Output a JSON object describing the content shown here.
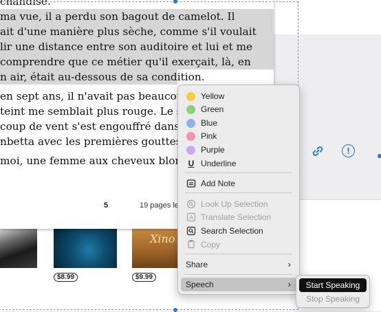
{
  "book": {
    "lines": [
      {
        "text": "chandise.",
        "highlighted": false
      },
      {
        "text": "ma vue, il a perdu son bagout de camelot. Il",
        "highlighted": true
      },
      {
        "text": "ait d'une manière plus sèche, comme s'il voulait",
        "highlighted": true
      },
      {
        "text": "lir une distance entre son auditoire et lui et me",
        "highlighted": true
      },
      {
        "text": "comprendre que ce métier qu'il exerçait, là, en",
        "highlighted": true
      },
      {
        "text": "n air, était au-dessous de sa condition.",
        "highlighted": true
      },
      {
        "text": "en sept ans, il n'avait pas beaucoup c",
        "highlighted": false
      },
      {
        "text": "teint me semblait plus rouge. Le soir",
        "highlighted": false
      },
      {
        "text": "coup de vent s'est engouffré dans l",
        "highlighted": false
      },
      {
        "text": "nbetta avec les premières gouttes de p",
        "highlighted": false
      },
      {
        "text": "moi, une femme aux cheveux blon",
        "highlighted": false
      }
    ],
    "page_number": "5",
    "pages_left": "19 pages le"
  },
  "store": {
    "cover3_title": "Xino",
    "prices": [
      "$8.99",
      "$9.99"
    ]
  },
  "context_menu": {
    "colors": [
      {
        "label": "Yellow",
        "color": "#f5cc3a"
      },
      {
        "label": "Green",
        "color": "#86d37a"
      },
      {
        "label": "Blue",
        "color": "#8fb1f1"
      },
      {
        "label": "Pink",
        "color": "#f592ae"
      },
      {
        "label": "Purple",
        "color": "#c7a8f1"
      }
    ],
    "underline": {
      "icon": "U",
      "label": "Underline"
    },
    "add_note": "Add Note",
    "look_up": "Look Up Selection",
    "translate": "Translate Selection",
    "search": "Search Selection",
    "copy": "Copy",
    "share": "Share",
    "speech": "Speech",
    "chevron": "›"
  },
  "speech_submenu": {
    "start": "Start Speaking",
    "stop": "Stop Speaking"
  },
  "side_icons": {
    "info_glyph": "!"
  }
}
